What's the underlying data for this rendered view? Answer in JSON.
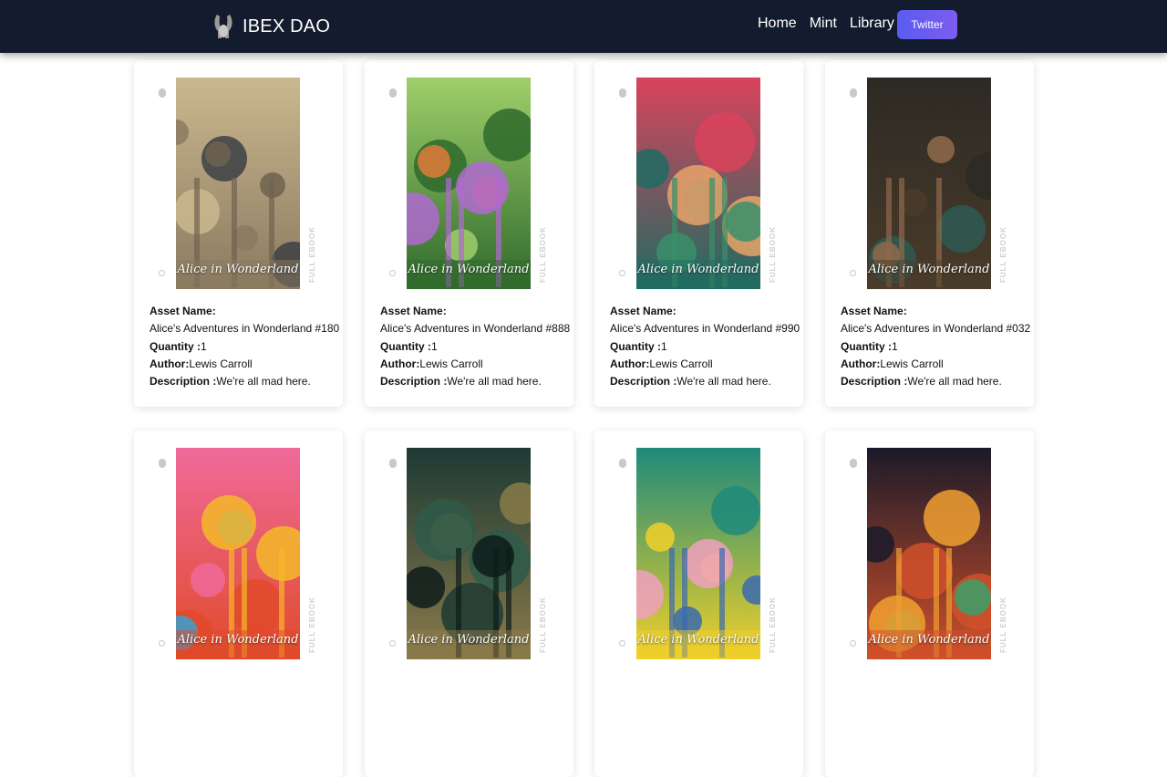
{
  "header": {
    "brand": "IBEX DAO",
    "logo_icon": "ibex-logo-icon",
    "nav": [
      {
        "label": "Home"
      },
      {
        "label": "Mint"
      },
      {
        "label": "Library"
      }
    ],
    "twitter_label": "Twitter",
    "colors": {
      "bar": "#131b2e",
      "button": "#5a5cf0"
    }
  },
  "labels": {
    "asset_name": "Asset Name:",
    "quantity": "Quantity :",
    "author": "Author:",
    "description": "Description :"
  },
  "books": [
    {
      "asset_name": "Alice's Adventures in Wonderland #180",
      "quantity": "1",
      "author": "Lewis Carroll",
      "description": "We're all mad here.",
      "cover_title": "Alice in Wonderland",
      "side_label": "FULL EBOOK",
      "palette": [
        "#cbb88f",
        "#8a7a60",
        "#3d3f45",
        "#6f6350"
      ]
    },
    {
      "asset_name": "Alice's Adventures in Wonderland #888",
      "quantity": "1",
      "author": "Lewis Carroll",
      "description": "We're all mad here.",
      "cover_title": "Alice in Wonderland",
      "side_label": "FULL EBOOK",
      "palette": [
        "#9fcf6a",
        "#2f6a2c",
        "#e07a38",
        "#b06ad0"
      ]
    },
    {
      "asset_name": "Alice's Adventures in Wonderland #990",
      "quantity": "1",
      "author": "Lewis Carroll",
      "description": "We're all mad here.",
      "cover_title": "Alice in Wonderland",
      "side_label": "FULL EBOOK",
      "palette": [
        "#d9435c",
        "#1f6b62",
        "#e8a36a",
        "#3a8f6a"
      ]
    },
    {
      "asset_name": "Alice's Adventures in Wonderland #032",
      "quantity": "1",
      "author": "Lewis Carroll",
      "description": "We're all mad here.",
      "cover_title": "Alice in Wonderland",
      "side_label": "FULL EBOOK",
      "palette": [
        "#2c2a24",
        "#4a3b2a",
        "#2d5a54",
        "#8f6a4a"
      ]
    },
    {
      "cover_title": "Alice in Wonderland",
      "side_label": "FULL EBOOK",
      "palette": [
        "#f06a9a",
        "#e04a2a",
        "#3aa0d0",
        "#f5b82a"
      ]
    },
    {
      "cover_title": "Alice in Wonderland",
      "side_label": "FULL EBOOK",
      "palette": [
        "#1d3a34",
        "#8a7a4a",
        "#2f5a4a",
        "#0e1c1a"
      ]
    },
    {
      "cover_title": "Alice in Wonderland",
      "side_label": "FULL EBOOK",
      "palette": [
        "#1f8a7a",
        "#f0d02a",
        "#f0a0c0",
        "#3a6ab0"
      ]
    },
    {
      "cover_title": "Alice in Wonderland",
      "side_label": "FULL EBOOK",
      "palette": [
        "#1a1a2a",
        "#d0502a",
        "#3aa06a",
        "#f0a030"
      ]
    }
  ]
}
